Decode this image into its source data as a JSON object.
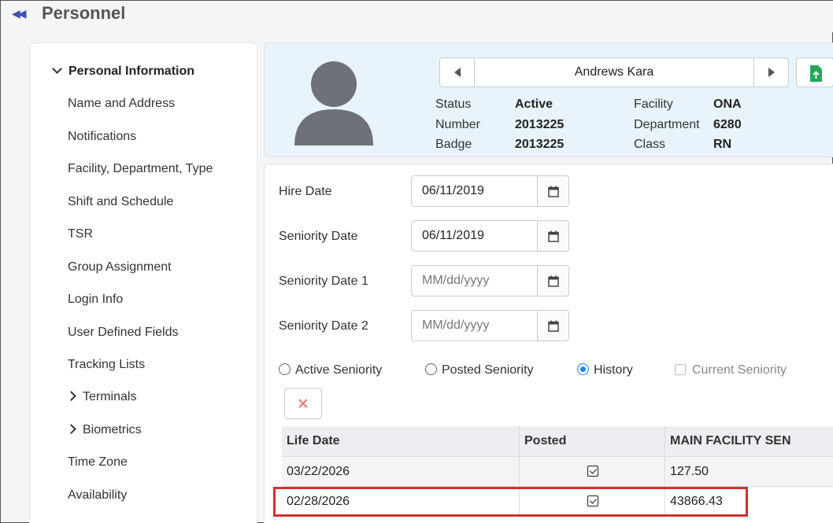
{
  "page": {
    "title": "Personnel"
  },
  "sidebar": {
    "section": "Personal Information",
    "items": [
      "Name and Address",
      "Notifications",
      "Facility, Department, Type",
      "Shift and Schedule",
      "TSR",
      "Group Assignment",
      "Login Info",
      "User Defined Fields",
      "Tracking Lists",
      "Terminals",
      "Biometrics",
      "Time Zone",
      "Availability"
    ]
  },
  "employee": {
    "name": "Andrews Kara",
    "status_label": "Status",
    "status": "Active",
    "number_label": "Number",
    "number": "2013225",
    "badge_label": "Badge",
    "badge": "2013225",
    "facility_label": "Facility",
    "facility": "ONA",
    "department_label": "Department",
    "department": "6280",
    "class_label": "Class",
    "class": "RN"
  },
  "dates": {
    "hire_label": "Hire Date",
    "hire_value": "06/11/2019",
    "seniority_label": "Seniority Date",
    "seniority_value": "06/11/2019",
    "seniority1_label": "Seniority Date 1",
    "seniority1_value": "",
    "seniority2_label": "Seniority Date 2",
    "seniority2_value": "",
    "placeholder": "MM/dd/yyyy"
  },
  "options": {
    "active": "Active Seniority",
    "posted": "Posted Seniority",
    "history": "History",
    "current": "Current Seniority",
    "selected": "History"
  },
  "table": {
    "columns": [
      "Life Date",
      "Posted",
      "MAIN FACILITY SEN"
    ],
    "rows": [
      {
        "life_date": "03/22/2026",
        "posted": true,
        "main_facility_sen": "127.50"
      },
      {
        "life_date": "02/28/2026",
        "posted": true,
        "main_facility_sen": "43866.43"
      }
    ]
  },
  "colors": {
    "accent": "#1e88e5",
    "highlight": "#d32f2f",
    "header_bg": "#e9f3fb",
    "export": "#26a65b"
  }
}
